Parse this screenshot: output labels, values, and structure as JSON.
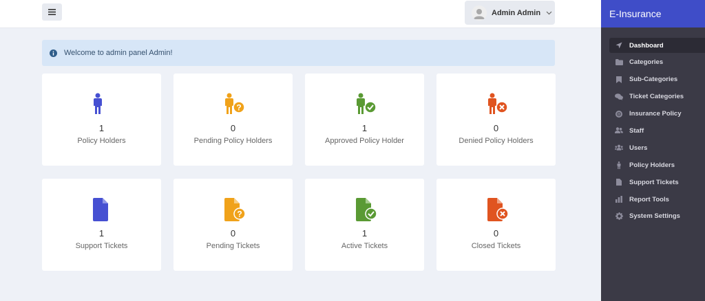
{
  "header": {
    "user_name": "Admin Admin"
  },
  "alert": {
    "message": "Welcome to admin panel Admin!"
  },
  "cards": [
    {
      "count": "1",
      "label": "Policy Holders",
      "color": "#4650d2",
      "icon": "person-icon"
    },
    {
      "count": "0",
      "label": "Pending Policy Holders",
      "color": "#f0a21a",
      "icon": "person-question-icon"
    },
    {
      "count": "1",
      "label": "Approved Policy Holder",
      "color": "#5a9a34",
      "icon": "person-check-icon"
    },
    {
      "count": "0",
      "label": "Denied Policy Holders",
      "color": "#e05420",
      "icon": "person-x-icon"
    },
    {
      "count": "1",
      "label": "Support Tickets",
      "color": "#4650d2",
      "icon": "file-icon"
    },
    {
      "count": "0",
      "label": "Pending Tickets",
      "color": "#f0a21a",
      "icon": "file-question-icon"
    },
    {
      "count": "1",
      "label": "Active Tickets",
      "color": "#5a9a34",
      "icon": "file-check-icon"
    },
    {
      "count": "0",
      "label": "Closed Tickets",
      "color": "#e05420",
      "icon": "file-x-icon"
    }
  ],
  "sidebar": {
    "brand": "E-Insurance",
    "items": [
      {
        "label": "Dashboard",
        "icon": "send-icon",
        "active": true
      },
      {
        "label": "Categories",
        "icon": "folder-icon"
      },
      {
        "label": "Sub-Categories",
        "icon": "bookmark-icon"
      },
      {
        "label": "Ticket Categories",
        "icon": "comments-icon"
      },
      {
        "label": "Insurance Policy",
        "icon": "lifering-icon"
      },
      {
        "label": "Staff",
        "icon": "users-icon"
      },
      {
        "label": "Users",
        "icon": "users-group-icon"
      },
      {
        "label": "Policy Holders",
        "icon": "person-icon"
      },
      {
        "label": "Support Tickets",
        "icon": "file-icon"
      },
      {
        "label": "Report Tools",
        "icon": "bar-chart-icon"
      },
      {
        "label": "System Settings",
        "icon": "gear-icon"
      }
    ]
  }
}
